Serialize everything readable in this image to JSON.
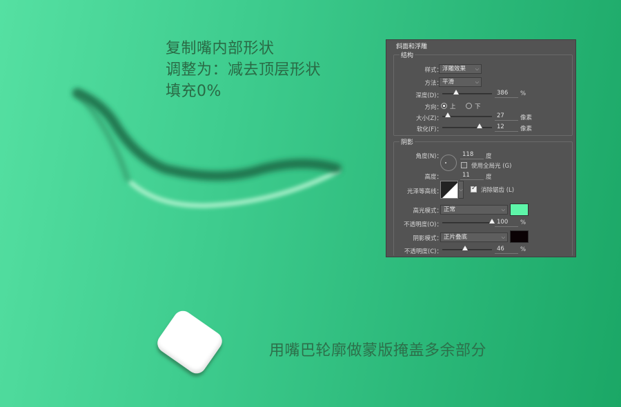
{
  "canvas": {
    "note_top": [
      "复制嘴内部形状",
      "调整为：减去顶层形状",
      "填充0%"
    ],
    "note_bottom": "用嘴巴轮廓做蒙版掩盖多余部分"
  },
  "panel": {
    "title": "斜面和浮雕",
    "structure": {
      "title": "结构",
      "style_label": "样式：",
      "style_value": "浮雕效果",
      "technique_label": "方法：",
      "technique_value": "平滑",
      "depth_label": "深度(D)：",
      "depth_value": "386",
      "depth_unit": "%",
      "depth_fraction": 0.28,
      "direction_label": "方向：",
      "direction_up": "上",
      "direction_down": "下",
      "direction_selected": "up",
      "size_label": "大小(Z)：",
      "size_value": "27",
      "size_unit": "像素",
      "size_fraction": 0.11,
      "soften_label": "软化(F)：",
      "soften_value": "12",
      "soften_unit": "像素",
      "soften_fraction": 0.75
    },
    "shading": {
      "title": "阴影",
      "angle_label": "角度(N)：",
      "angle_value": "118",
      "angle_unit": "度",
      "global_light_label": "使用全局光 (G)",
      "global_light_checked": false,
      "altitude_label": "高度：",
      "altitude_value": "11",
      "altitude_unit": "度",
      "gloss_label": "光泽等高线：",
      "antialias_label": "消除锯齿 (L)",
      "antialias_checked": true,
      "highlight_mode_label": "高光模式：",
      "highlight_mode_value": "正常",
      "highlight_color": "#5ef6a9",
      "highlight_opacity_label": "不透明度(O)：",
      "highlight_opacity_value": "100",
      "highlight_opacity_unit": "%",
      "highlight_opacity_fraction": 1.0,
      "shadow_mode_label": "阴影模式：",
      "shadow_mode_value": "正片叠底",
      "shadow_color": "#0a0204",
      "shadow_opacity_label": "不透明度(C)：",
      "shadow_opacity_value": "46",
      "shadow_opacity_unit": "%",
      "shadow_opacity_fraction": 0.46
    }
  },
  "icons": {
    "select_chevron": "chevron-down-icon",
    "eraser": "eraser-icon"
  }
}
